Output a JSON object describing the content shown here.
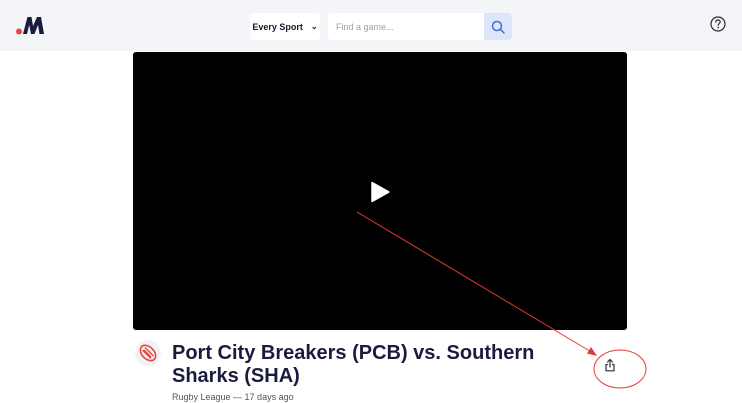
{
  "header": {
    "logo_icon": "brand-logo-icon",
    "sport_select": {
      "selected": "Every Sport",
      "icon": "chevron-down-icon"
    },
    "search": {
      "placeholder": "Find a game...",
      "value": "",
      "icon": "search-icon"
    },
    "help_icon": "help-circle-icon"
  },
  "video": {
    "play_icon": "play-icon"
  },
  "game": {
    "sport_icon": "rugby-ball-icon",
    "title": "Port City Breakers (PCB) vs. Southern Sharks (SHA)",
    "meta": "Rugby League — 17 days ago",
    "share_icon": "share-icon"
  },
  "colors": {
    "brand_red": "#e8453c",
    "brand_navy": "#1b1b40",
    "header_bg": "#f3f5f8",
    "search_button_bg": "#dbe6fb",
    "annotation_red": "#e53935"
  }
}
